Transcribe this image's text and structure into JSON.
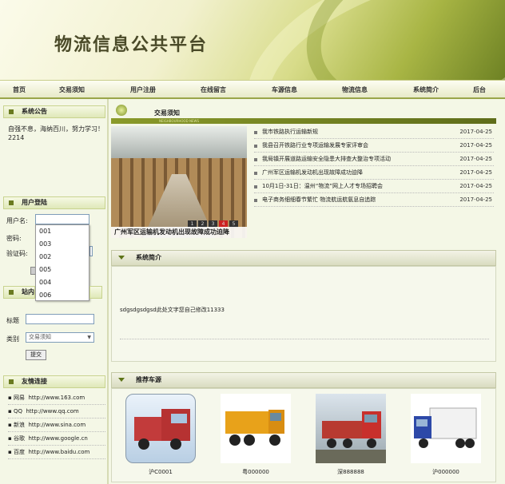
{
  "header": {
    "title": "物流信息公共平台"
  },
  "nav": [
    "首页",
    "交易须知",
    "用户注册",
    "在线留言",
    "车源信息",
    "物流信息",
    "系统简介",
    "后台"
  ],
  "notice": {
    "title": "系统公告",
    "text": "自强不息，海纳百川，努力学习！2214"
  },
  "login": {
    "title": "用户登陆",
    "username_label": "用户名:",
    "password_label": "密码:",
    "captcha_label": "验证码:",
    "options": [
      "001",
      "003",
      "002",
      "005",
      "004",
      "006"
    ]
  },
  "search": {
    "title": "站内",
    "field_label": "标题",
    "category_label": "类别",
    "category_value": "交易须知",
    "submit_label": "提交"
  },
  "links": {
    "title": "友情连接",
    "items": [
      {
        "name": "网易",
        "url": "http://www.163.com"
      },
      {
        "name": "QQ",
        "url": "http://www.qq.com"
      },
      {
        "name": "新浪",
        "url": "http://www.sina.com"
      },
      {
        "name": "谷歌",
        "url": "http://www.google.cn"
      },
      {
        "name": "百度",
        "url": "http://www.baidu.com"
      }
    ]
  },
  "trade": {
    "title": "交易须知",
    "sub": "NEIGHBOURHOOD NEWS",
    "caption": "广州军区运输机发动机出现故障成功迫降",
    "pager": [
      "1",
      "2",
      "3",
      "4",
      "5"
    ],
    "news": [
      {
        "title": "我市铁路执行运输新规",
        "date": "2017-04-25"
      },
      {
        "title": "我县召开铁路行业专项运输发展专家评审会",
        "date": "2017-04-25"
      },
      {
        "title": "我局镇开展道路运输安全隐患大排查大整治专项活动",
        "date": "2017-04-25"
      },
      {
        "title": "广州军区运输机发动机出现故障成功迫降",
        "date": "2017-04-25"
      },
      {
        "title": "10月1日-31日：温州“物流”网上人才专场招聘会",
        "date": "2017-04-25"
      },
      {
        "title": "电子商务细细春节繁忙 物流航运航氨息自追踪",
        "date": "2017-04-25"
      }
    ]
  },
  "system": {
    "title": "系统简介",
    "text": "sdgsdgsdgsd此处文字您自己修改11333"
  },
  "cars": {
    "title": "推荐车源",
    "items": [
      {
        "plate": "沪C0001",
        "color": "#c23b3b"
      },
      {
        "plate": "粤000000",
        "color": "#e8a21a"
      },
      {
        "plate": "深888888",
        "color": "#c8302c"
      },
      {
        "plate": "沪000000",
        "color": "#2d49a8"
      }
    ]
  }
}
